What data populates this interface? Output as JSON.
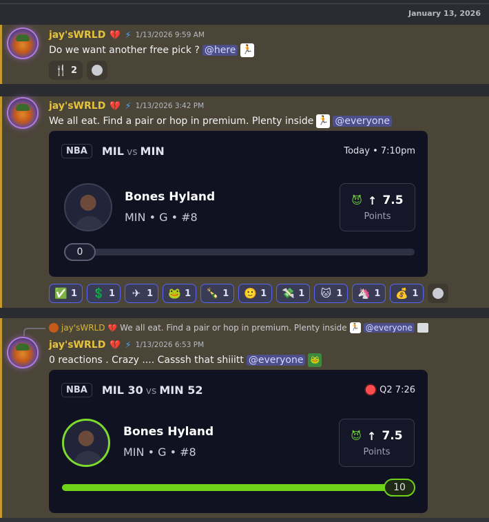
{
  "divider": {
    "date": "January 13, 2026"
  },
  "messages": [
    {
      "username": "jay'sWRLD",
      "timestamp": "1/13/2026 9:59 AM",
      "text": "Do we want another free pick ?",
      "mention": "@here",
      "reactions": [
        {
          "emoji": "fork-knife",
          "glyph": "🍴",
          "count": "2"
        }
      ]
    },
    {
      "username": "jay'sWRLD",
      "timestamp": "1/13/2026 3:42 PM",
      "text": "We all eat. Find a pair or hop in premium. Plenty inside",
      "mention": "@everyone",
      "card": {
        "league": "NBA",
        "team1": "MIL",
        "vs": "vs",
        "team2": "MIN",
        "time": "Today • 7:10pm",
        "player": "Bones Hyland",
        "meta": "MIN • G • #8",
        "line": "7.5",
        "stat": "Points",
        "progress_value": "0",
        "progress_fraction": 0
      },
      "reactions": [
        {
          "emoji": "check",
          "glyph": "✅",
          "count": "1"
        },
        {
          "emoji": "dollar",
          "glyph": "💲",
          "count": "1"
        },
        {
          "emoji": "plane",
          "glyph": "✈",
          "count": "1"
        },
        {
          "emoji": "pepe-dance",
          "glyph": "🐸",
          "count": "1"
        },
        {
          "emoji": "champagne",
          "glyph": "🍾",
          "count": "1"
        },
        {
          "emoji": "face",
          "glyph": "🙂",
          "count": "1"
        },
        {
          "emoji": "money-wings",
          "glyph": "💸",
          "count": "1"
        },
        {
          "emoji": "cat",
          "glyph": "🐱",
          "count": "1"
        },
        {
          "emoji": "unicorn",
          "glyph": "🦄",
          "count": "1"
        },
        {
          "emoji": "money-bag",
          "glyph": "💰",
          "count": "1"
        }
      ]
    },
    {
      "reply_username": "jay'sWRLD",
      "reply_text": "We all eat. Find a pair or hop in premium. Plenty inside",
      "reply_mention": "@everyone",
      "username": "jay'sWRLD",
      "timestamp": "1/13/2026 6:53 PM",
      "text": "0 reactions . Crazy .... Casssh that shiiitt",
      "mention": "@everyone",
      "card": {
        "league": "NBA",
        "team1": "MIL 30",
        "vs": "vs",
        "team2": "MIN 52",
        "time": "Q2 7:26",
        "player": "Bones Hyland",
        "meta": "MIN • G • #8",
        "line": "7.5",
        "stat": "Points",
        "progress_value": "10",
        "progress_fraction": 1
      }
    }
  ],
  "colors": {
    "accent_live": "#6ed41a",
    "username": "#e6c33d",
    "mention_bg": "#4d4f8a"
  }
}
